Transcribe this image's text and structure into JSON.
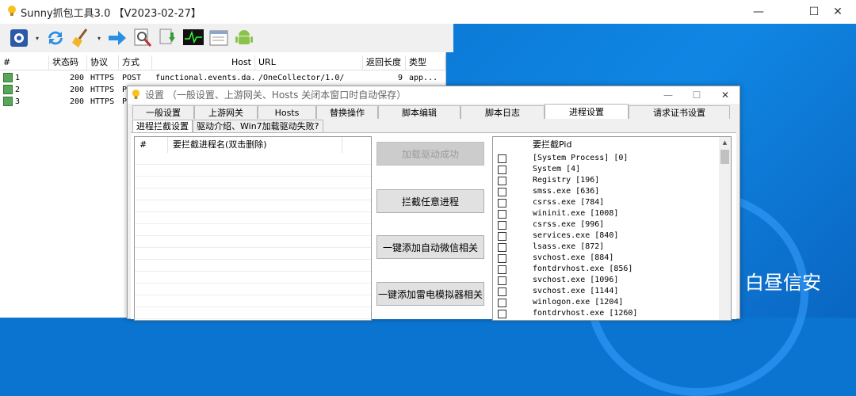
{
  "app": {
    "title": "Sunny抓包工具3.0 【V2023-02-27】",
    "minimize": "—",
    "maximize": "☐",
    "close": "✕"
  },
  "toolbar": {
    "icons": [
      "gear-icon",
      "refresh-icon",
      "broom-icon",
      "arrow-right-icon",
      "magnifier-icon",
      "download-icon",
      "monitor-icon",
      "notepad-icon",
      "android-icon"
    ],
    "caret": "▾"
  },
  "grid": {
    "headers": [
      "#",
      "状态码",
      "协议",
      "方式",
      "Host",
      "URL",
      "返回长度",
      "类型"
    ],
    "rows": [
      {
        "id": "1",
        "status": "200",
        "proto": "HTTPS",
        "method": "POST",
        "host": "functional.events.da...",
        "url": "/OneCollector/1.0/",
        "len": "9",
        "type": "app..."
      },
      {
        "id": "2",
        "status": "200",
        "proto": "HTTPS",
        "method": "P",
        "host": "",
        "url": "",
        "len": "",
        "type": ""
      },
      {
        "id": "3",
        "status": "200",
        "proto": "HTTPS",
        "method": "P",
        "host": "",
        "url": "",
        "len": "",
        "type": ""
      }
    ]
  },
  "dialog": {
    "title": "设置 （一般设置、上游网关、Hosts 关闭本窗口时自动保存）",
    "minimize": "—",
    "maximize": "☐",
    "close": "✕",
    "tabs": [
      "一般设置",
      "上游网关",
      "Hosts",
      "替换操作",
      "脚本编辑",
      "脚本日志",
      "进程设置",
      "请求证书设置"
    ],
    "subtabs": [
      "进程拦截设置",
      "驱动介绍、Win7加载驱动失败?"
    ],
    "left_list": {
      "headers": [
        "#",
        "要拦截进程名(双击删除)"
      ]
    },
    "buttons": {
      "load_driver": "加载驱动成功",
      "intercept_any": "拦截任意进程",
      "add_wechat": "一键添加自动微信相关",
      "add_emulator": "一键添加雷电模拟器相关"
    },
    "right_list": {
      "header": "要拦截Pid",
      "items": [
        "[System Process] [0]",
        "System [4]",
        "Registry [196]",
        "smss.exe [636]",
        "csrss.exe [784]",
        "wininit.exe [1008]",
        "csrss.exe [996]",
        "services.exe [840]",
        "lsass.exe [872]",
        "svchost.exe [884]",
        "fontdrvhost.exe [856]",
        "svchost.exe [1096]",
        "svchost.exe [1144]",
        "winlogon.exe [1204]",
        "fontdrvhost.exe [1260]"
      ]
    }
  },
  "watermark": {
    "text": "白昼信安"
  },
  "colors": {
    "desktop": "#0b7ad6",
    "accent_green": "#5aa55a"
  }
}
